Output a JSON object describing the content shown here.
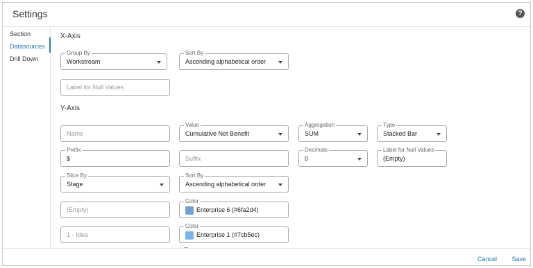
{
  "window": {
    "title": "Settings",
    "help_icon": "?"
  },
  "sidebar": {
    "items": [
      {
        "label": "Section"
      },
      {
        "label": "Datasources",
        "active": true
      },
      {
        "label": "Drill Down"
      }
    ]
  },
  "xaxis": {
    "title": "X-Axis",
    "group_by": {
      "label": "Group By",
      "value": "Workstream"
    },
    "sort_by": {
      "label": "Sort By",
      "value": "Ascending alphabetical order"
    },
    "null_label": {
      "placeholder": "Label for Null Values"
    }
  },
  "yaxis": {
    "title": "Y-Axis",
    "name": {
      "placeholder": "Name"
    },
    "value": {
      "label": "Value",
      "value": "Cumulative Net Benefit"
    },
    "aggregation": {
      "label": "Aggregation",
      "value": "SUM"
    },
    "type": {
      "label": "Type",
      "value": "Stacked Bar"
    },
    "prefix": {
      "label": "Prefix",
      "value": "$"
    },
    "suffix": {
      "placeholder": "Suffix"
    },
    "decimals": {
      "label": "Decimals",
      "value": "0"
    },
    "null_label": {
      "label": "Label for Null Values",
      "value": "(Empty)"
    },
    "slice_by": {
      "label": "Slice By",
      "value": "Stage"
    },
    "sort_by": {
      "label": "Sort By",
      "value": "Ascending alphabetical order"
    },
    "slices": [
      {
        "name_placeholder": "(Empty)",
        "color_label": "Color",
        "color_name": "Enterprise 6 (#6fa2d4)",
        "color": "#6fa2d4"
      },
      {
        "name_placeholder": "1 - Idea",
        "color_label": "Color",
        "color_name": "Enterprise 1 (#7cb5ec)",
        "color": "#7cb5ec"
      }
    ]
  },
  "footer": {
    "cancel": "Cancel",
    "save": "Save"
  },
  "colors": {
    "accent": "#2a7ab0"
  }
}
